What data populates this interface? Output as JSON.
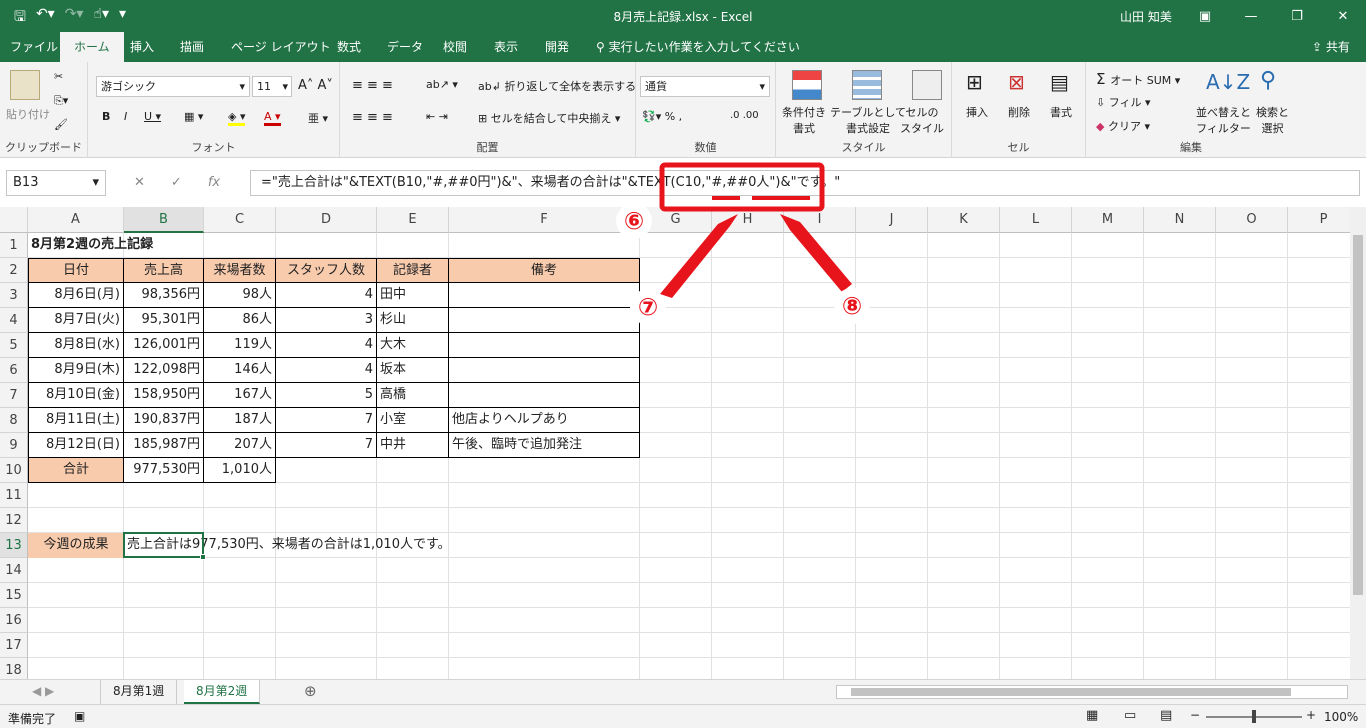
{
  "window": {
    "title": "8月売上記録.xlsx  -  Excel",
    "user": "山田 知美"
  },
  "tabs": [
    "ファイル",
    "ホーム",
    "挿入",
    "描画",
    "ページ レイアウト",
    "数式",
    "データ",
    "校閲",
    "表示",
    "開発"
  ],
  "search_placeholder": "実行したい作業を入力してください",
  "share": "共有",
  "ribbon": {
    "clipboard": {
      "paste": "貼り付け",
      "label": "クリップボード"
    },
    "font": {
      "name": "游ゴシック",
      "size": "11",
      "label": "フォント"
    },
    "alignment": {
      "wrap": "折り返して全体を表示する",
      "merge": "セルを結合して中央揃え",
      "label": "配置"
    },
    "number": {
      "format": "通貨",
      "label": "数値"
    },
    "styles": {
      "cond": "条件付き\n書式",
      "table": "テーブルとして\n書式設定",
      "cell": "セルの\nスタイル",
      "label": "スタイル"
    },
    "cells": {
      "insert": "挿入",
      "delete": "削除",
      "format": "書式",
      "label": "セル"
    },
    "editing": {
      "autosum": "オート SUM",
      "fill": "フィル",
      "clear": "クリア",
      "sort": "並べ替えと\nフィルター",
      "find": "検索と\n選択",
      "label": "編集"
    }
  },
  "namebox": "B13",
  "formula": "=\"売上合計は\"&TEXT(B10,\"#,##0円\")&\"、来場者の合計は\"&TEXT(C10,\"#,##0人\")&\"です。\"",
  "columns": [
    "A",
    "B",
    "C",
    "D",
    "E",
    "F",
    "G",
    "H",
    "I",
    "J",
    "K",
    "L",
    "M",
    "N",
    "O",
    "P"
  ],
  "rows": [
    "1",
    "2",
    "3",
    "4",
    "5",
    "6",
    "7",
    "8",
    "9",
    "10",
    "11",
    "12",
    "13",
    "14",
    "15",
    "16",
    "17",
    "18"
  ],
  "sheet": {
    "title": "8月第2週の売上記録",
    "headers": [
      "日付",
      "売上高",
      "来場者数",
      "スタッフ人数",
      "記録者",
      "備考"
    ],
    "data": [
      [
        "8月6日(月)",
        "98,356円",
        "98人",
        "4",
        "田中",
        ""
      ],
      [
        "8月7日(火)",
        "95,301円",
        "86人",
        "3",
        "杉山",
        ""
      ],
      [
        "8月8日(水)",
        "126,001円",
        "119人",
        "4",
        "大木",
        ""
      ],
      [
        "8月9日(木)",
        "122,098円",
        "146人",
        "4",
        "坂本",
        ""
      ],
      [
        "8月10日(金)",
        "158,950円",
        "167人",
        "5",
        "高橋",
        ""
      ],
      [
        "8月11日(土)",
        "190,837円",
        "187人",
        "7",
        "小室",
        "他店よりヘルプあり"
      ],
      [
        "8月12日(日)",
        "185,987円",
        "207人",
        "7",
        "中井",
        "午後、臨時で追加発注"
      ]
    ],
    "total_label": "合計",
    "total_sales": "977,530円",
    "total_visitors": "1,010人",
    "summary_label": "今週の成果",
    "summary_value": "売上合計は977,530円、来場者の合計は1,010人です。"
  },
  "sheet_tabs": [
    "8月第1週",
    "8月第2週"
  ],
  "status": {
    "ready": "準備完了",
    "zoom": "100%"
  },
  "callouts": [
    "⑥",
    "⑦",
    "⑧"
  ],
  "colors": {
    "accent": "#217346",
    "header_fill": "#f8cbad",
    "callout": "#e8141b"
  }
}
